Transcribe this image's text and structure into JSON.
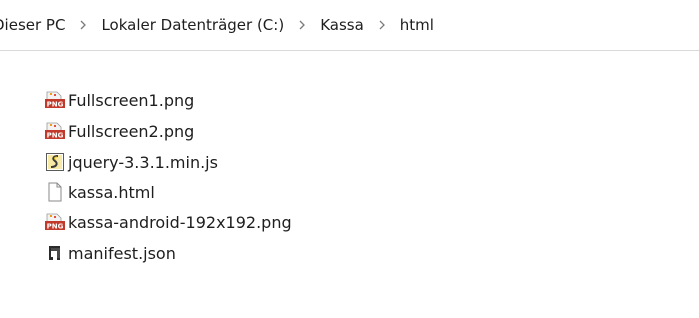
{
  "breadcrumb": {
    "items": [
      "Dieser PC",
      "Lokaler Datenträger (C:)",
      "Kassa",
      "html"
    ],
    "separator_icon": "chevron-right-icon"
  },
  "files": [
    {
      "name": "Fullscreen1.png",
      "icon": "png-file-icon"
    },
    {
      "name": "Fullscreen2.png",
      "icon": "png-file-icon"
    },
    {
      "name": "jquery-3.3.1.min.js",
      "icon": "js-script-icon"
    },
    {
      "name": "kassa.html",
      "icon": "blank-file-icon"
    },
    {
      "name": "kassa-android-192x192.png",
      "icon": "png-file-icon"
    },
    {
      "name": "manifest.json",
      "icon": "json-file-icon"
    }
  ],
  "colors": {
    "text": "#1e1e1e",
    "separator": "#7a7a7a",
    "png_badge": "#c0392b",
    "png_badge_top": "#f39c12"
  }
}
